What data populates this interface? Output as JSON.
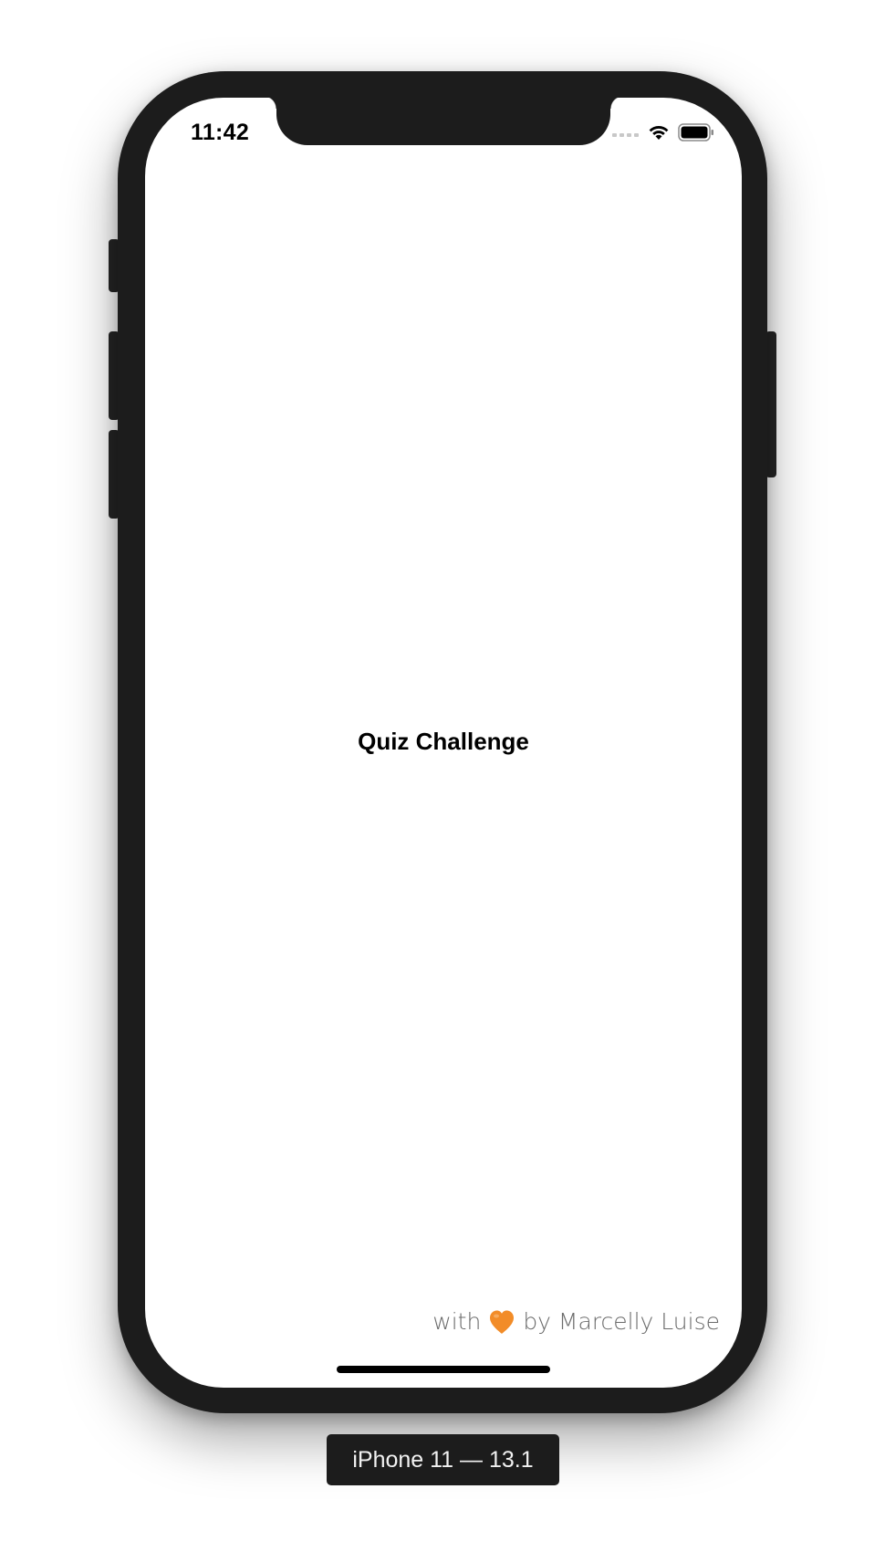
{
  "status_bar": {
    "time": "11:42"
  },
  "screen": {
    "title": "Quiz Challenge",
    "credit": {
      "prefix": "with",
      "icon": "orange-heart-icon",
      "suffix": "by Marcelly Luise"
    }
  },
  "simulator": {
    "device_label": "iPhone 11 — 13.1"
  },
  "colors": {
    "device_frame": "#1c1c1c",
    "screen_bg": "#ffffff",
    "title_text": "#000000",
    "credit_text": "#6b6b6b",
    "heart": "#f28c28"
  }
}
